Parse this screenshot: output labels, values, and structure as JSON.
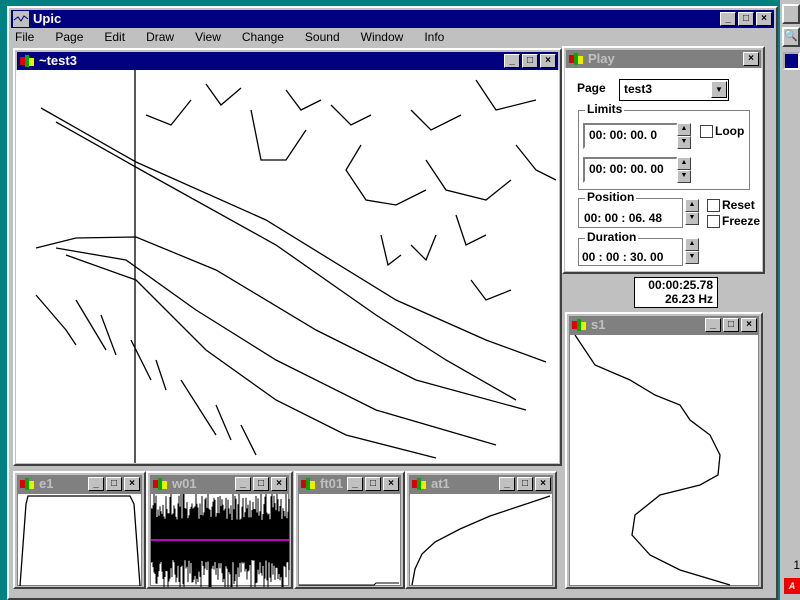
{
  "app": {
    "title": "Upic"
  },
  "menu": [
    "File",
    "Page",
    "Edit",
    "Draw",
    "View",
    "Change",
    "Sound",
    "Window",
    "Info"
  ],
  "canvas_window": {
    "title": "~test3"
  },
  "play": {
    "title": "Play",
    "page_label": "Page",
    "page_value": "test3",
    "limits_label": "Limits",
    "limit_start": "00: 00: 00. 0",
    "limit_end": "00: 00: 00. 00",
    "loop_label": "Loop",
    "position_label": "Position",
    "position_value": "00: 00 : 06.  48",
    "reset_label": "Reset",
    "freeze_label": "Freeze",
    "duration_label": "Duration",
    "duration_value": "00 : 00 : 30.  00"
  },
  "readout": {
    "time": "00:00:25.78",
    "freq": "26.23 Hz"
  },
  "subwindows": [
    "s1",
    "e1",
    "w01",
    "ft01",
    "at1"
  ],
  "taskbar": {
    "counter": "1",
    "logo": "ATI"
  },
  "colors": {
    "desktop": "#008080",
    "active_title": "#000080",
    "inactive_title": "#808080",
    "wave_center": "#ff00ff"
  }
}
